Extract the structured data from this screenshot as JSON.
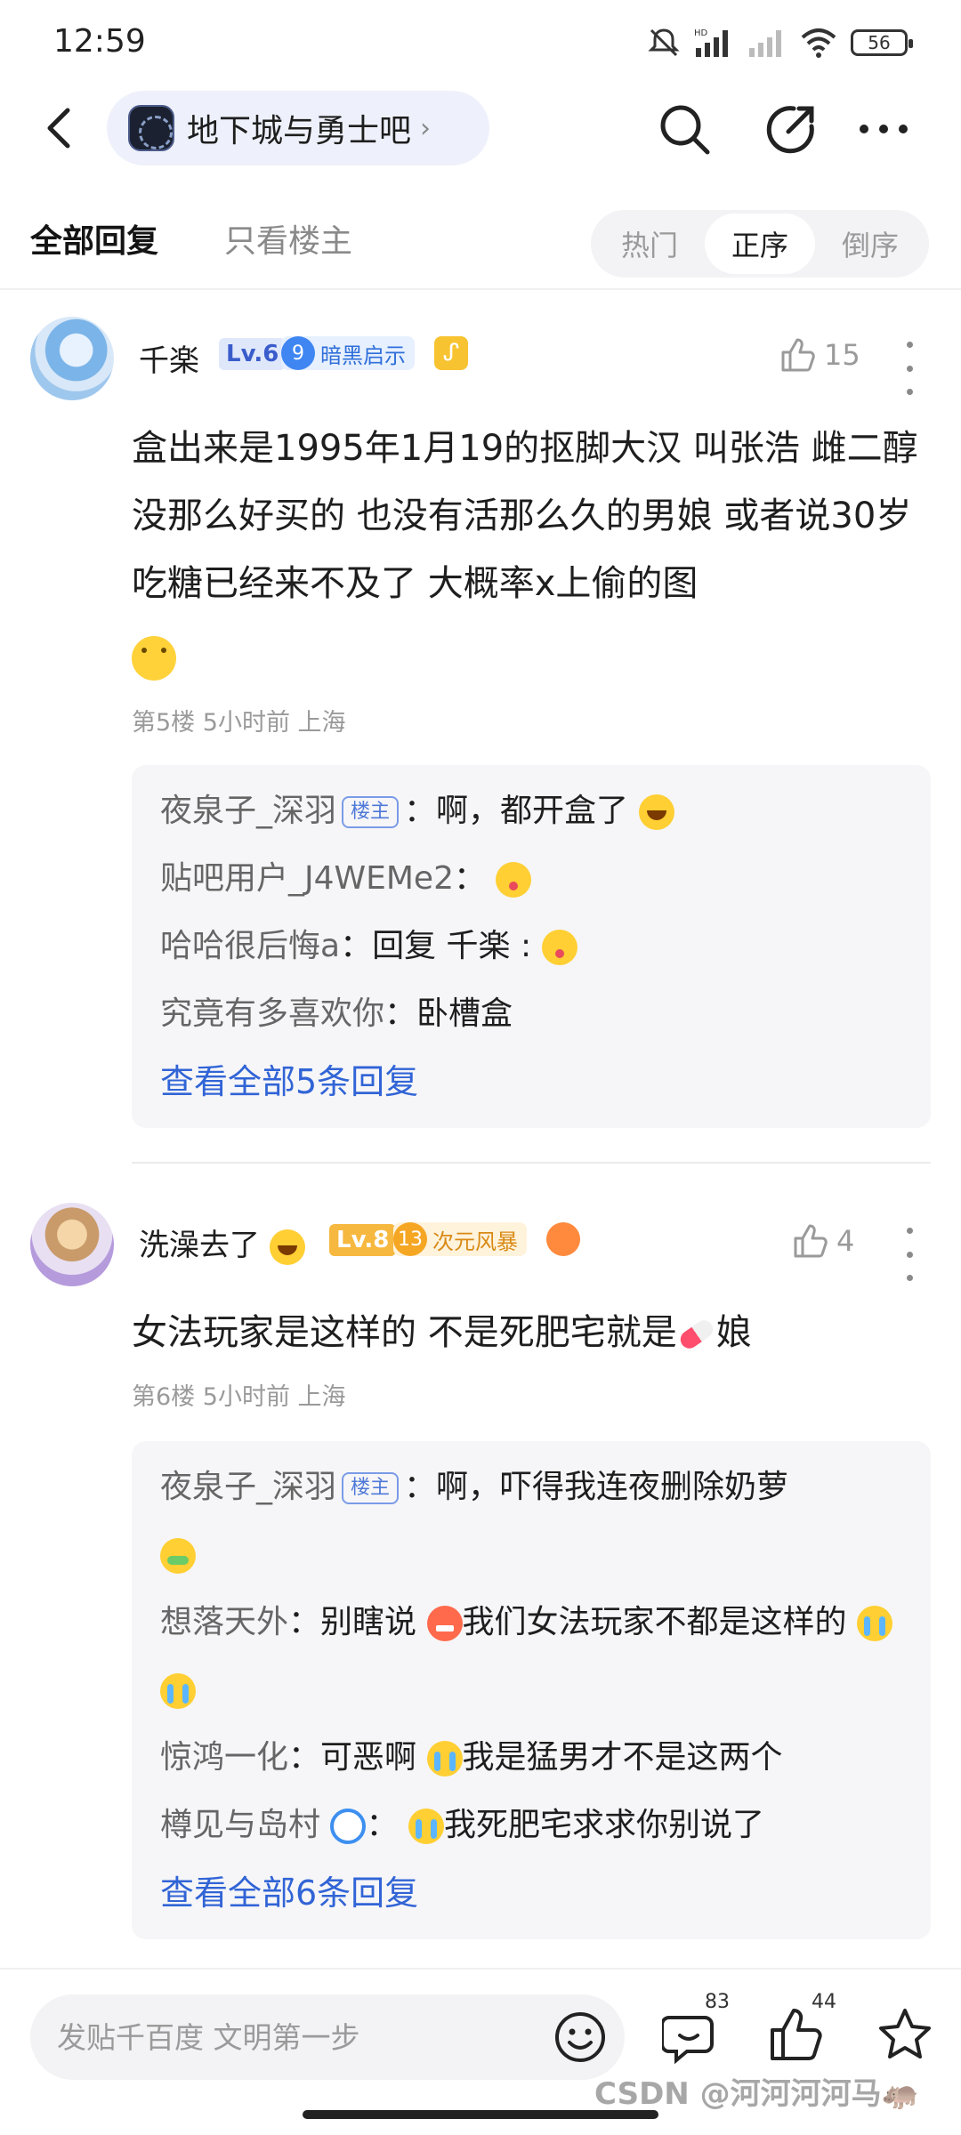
{
  "status_bar": {
    "time": "12:59",
    "battery": "56",
    "icons": [
      "mute-icon",
      "hd-signal-icon",
      "signal-icon",
      "wifi-icon",
      "battery-icon"
    ]
  },
  "header": {
    "forum_name": "地下城与勇士吧",
    "chevron": "›"
  },
  "tabs": {
    "all_replies": "全部回复",
    "only_op": "只看楼主",
    "sort_options": [
      "热门",
      "正序",
      "倒序"
    ],
    "active_sort": "正序"
  },
  "posts": [
    {
      "username": "千楽",
      "level": "Lv.6",
      "badge_num": "9",
      "badge_text": "暗黑启示",
      "likes": "15",
      "content": "盒出来是1995年1月19的抠脚大汉 叫张浩 雌二醇没那么好买的 也没有活那么久的男娘 或者说30岁吃糖已经来不及了 大概率x上偷的图",
      "meta": "第5楼  5小时前  上海",
      "replies": [
        {
          "name": "夜泉子_深羽",
          "is_op": true,
          "text": "啊，都开盒了"
        },
        {
          "name": "贴吧用户_J4WEMe2",
          "is_op": false,
          "text": ""
        },
        {
          "name": "哈哈很后悔a",
          "is_op": false,
          "text": "回复 千楽 :"
        },
        {
          "name": "究竟有多喜欢你",
          "is_op": false,
          "text": "卧槽盒"
        }
      ],
      "view_all": "查看全部5条回复"
    },
    {
      "username": "洗澡去了",
      "level": "Lv.8",
      "badge_num": "13",
      "badge_text": "次元风暴",
      "likes": "4",
      "content_a": "女法玩家是这样的 不是死肥宅就是",
      "content_b": "娘",
      "meta": "第6楼  5小时前  上海",
      "replies": [
        {
          "name": "夜泉子_深羽",
          "is_op": true,
          "text": "啊，吓得我连夜删除奶萝"
        },
        {
          "name": "想落天外",
          "is_op": false,
          "text_a": "别瞎说",
          "text_b": "我们女法玩家不都是这样的"
        },
        {
          "name": "惊鸿一化",
          "is_op": false,
          "text_a": "可恶啊",
          "text_b": "我是猛男才不是这两个"
        },
        {
          "name": "樽见与岛村",
          "is_op": false,
          "text": "我死肥宅求求你别说了"
        }
      ],
      "view_all": "查看全部6条回复"
    }
  ],
  "op_tag": "楼主",
  "bottom_bar": {
    "input_placeholder": "发贴千百度 文明第一步",
    "comment_count": "83",
    "like_count": "44"
  },
  "watermark": "CSDN @河河河河马🦛",
  "colors": {
    "accent_blue": "#3164d6",
    "pill_bg": "#eef1fb",
    "reply_bg": "#f6f6f8",
    "level_orange": "#f7b840"
  }
}
